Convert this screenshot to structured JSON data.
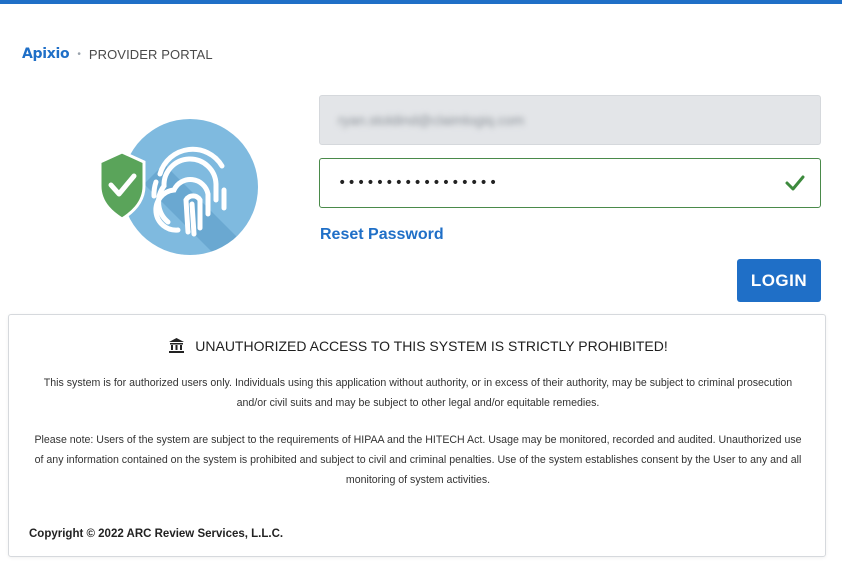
{
  "brand": {
    "logo_text": "Apixio",
    "separator": "•",
    "portal_name": "PROVIDER PORTAL"
  },
  "login_form": {
    "email_value": "ryan.stoldind@claimlogiq.com",
    "password_value": "•••••••••••••••••",
    "password_valid": true,
    "reset_password_label": "Reset Password",
    "login_button_label": "LOGIN"
  },
  "notice": {
    "title": "UNAUTHORIZED ACCESS TO THIS SYSTEM IS STRICTLY PROHIBITED!",
    "paragraph_1": "This system is for authorized users only. Individuals using this application without authority, or in excess of their authority, may be subject to criminal prosecution and/or civil suits and may be subject to other legal and/or equitable remedies.",
    "paragraph_2": "Please note: Users of the system are subject to the requirements of HIPAA and the HITECH Act. Usage may be monitored, recorded and audited. Unauthorized use of any information contained on the system is prohibited and subject to civil and criminal penalties. Use of the system establishes consent by the User to any and all monitoring of system activities.",
    "copyright": "Copyright © 2022 ARC Review Services, L.L.C."
  },
  "colors": {
    "accent": "#1f6fc7",
    "success": "#4a8a4a",
    "hero_circle": "#7fbadf",
    "shield": "#5aa45a"
  },
  "icons": {
    "hero": "fingerprint-shield-icon",
    "valid": "checkmark-icon",
    "notice": "bank-building-icon"
  }
}
